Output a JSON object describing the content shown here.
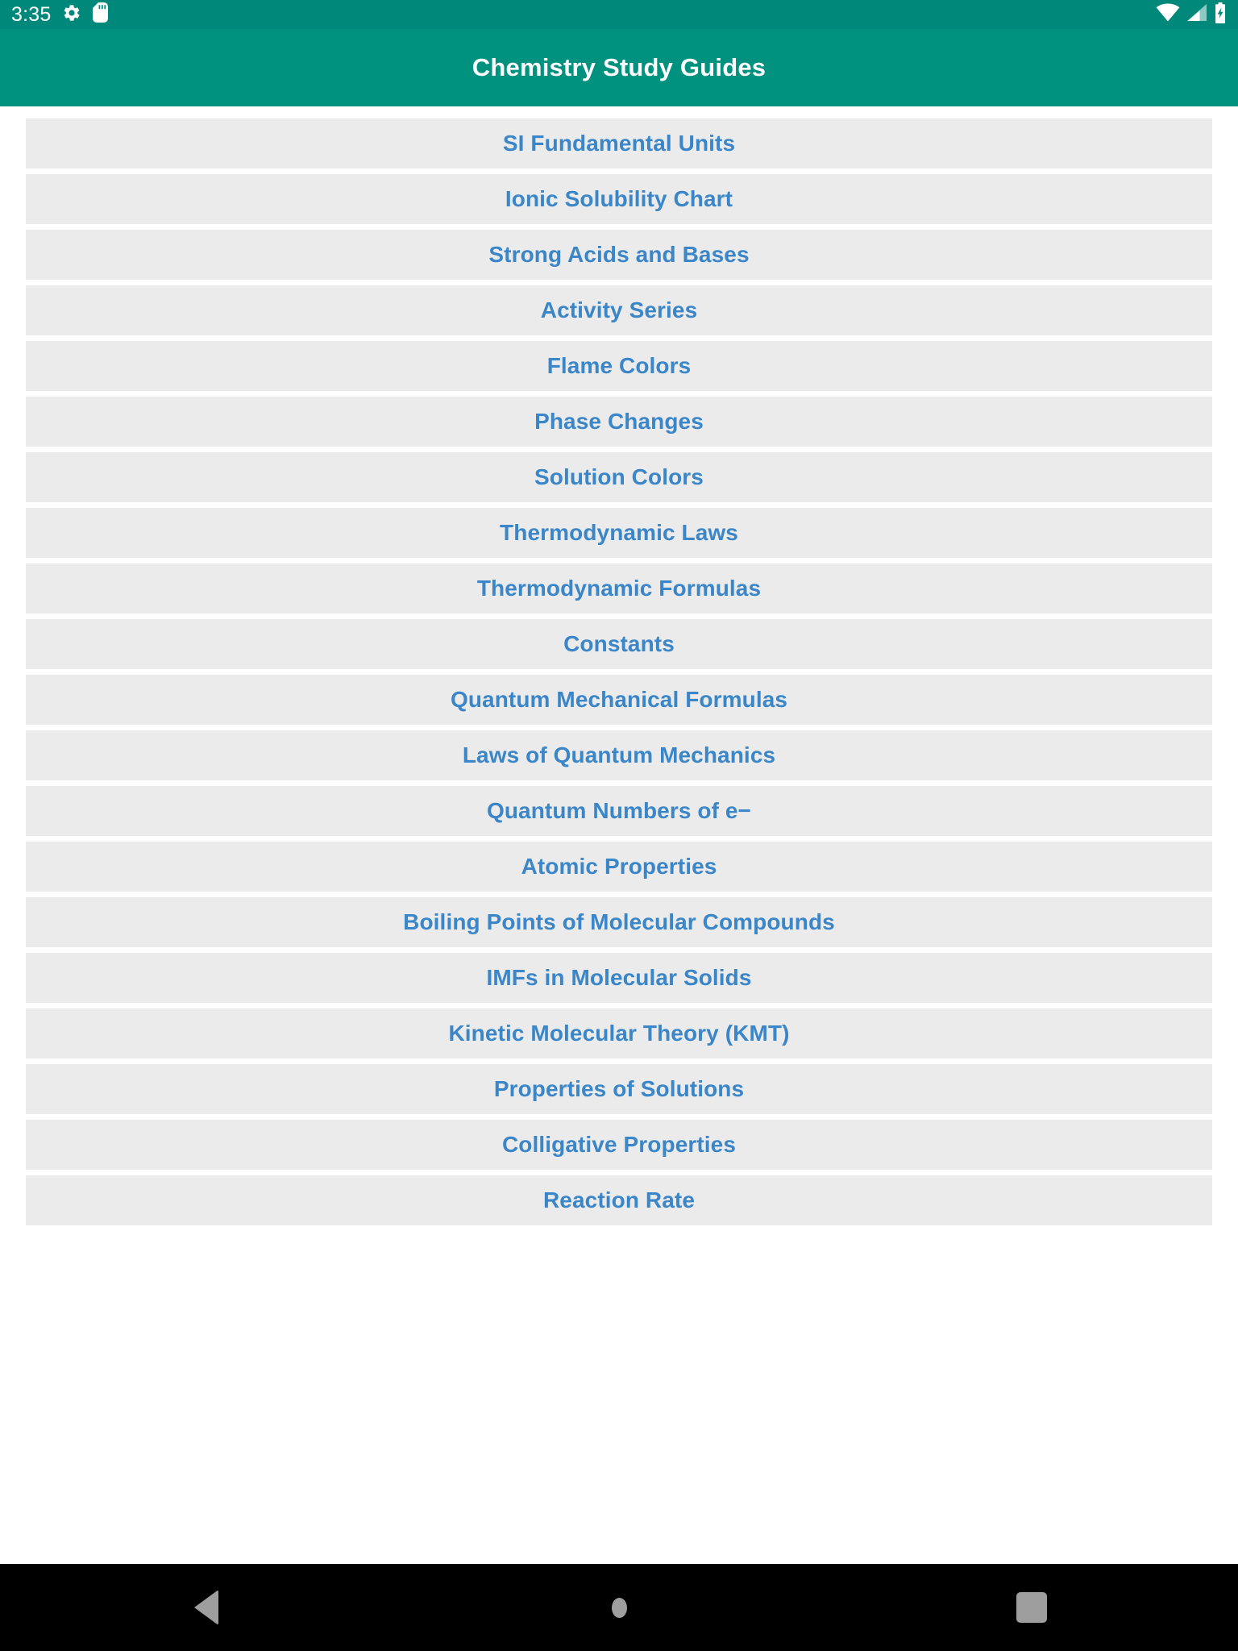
{
  "status_bar": {
    "clock": "3:35",
    "left_icons": [
      {
        "name": "settings-gear-icon",
        "glyph": "gear"
      },
      {
        "name": "sd-card-icon",
        "glyph": "sd-card"
      }
    ],
    "right_icons": [
      {
        "name": "wifi-icon",
        "glyph": "wifi"
      },
      {
        "name": "cellular-signal-icon",
        "glyph": "signal"
      },
      {
        "name": "battery-charging-icon",
        "glyph": "battery-charging"
      }
    ],
    "background_color": "#00897b",
    "foreground_color": "#ffffff"
  },
  "app_bar": {
    "title": "Chemistry Study Guides",
    "background_color": "#00917f",
    "title_color": "#ffffff"
  },
  "list": {
    "item_background_color": "#ebebeb",
    "item_text_color": "#3a86c8",
    "items": [
      {
        "label": "SI Fundamental Units"
      },
      {
        "label": "Ionic Solubility Chart"
      },
      {
        "label": "Strong Acids and Bases"
      },
      {
        "label": "Activity Series"
      },
      {
        "label": "Flame Colors"
      },
      {
        "label": "Phase Changes"
      },
      {
        "label": "Solution Colors"
      },
      {
        "label": "Thermodynamic Laws"
      },
      {
        "label": "Thermodynamic Formulas"
      },
      {
        "label": "Constants"
      },
      {
        "label": "Quantum Mechanical Formulas"
      },
      {
        "label": "Laws of Quantum Mechanics"
      },
      {
        "label": "Quantum Numbers of e−"
      },
      {
        "label": "Atomic Properties"
      },
      {
        "label": "Boiling Points of Molecular Compounds"
      },
      {
        "label": "IMFs in Molecular Solids"
      },
      {
        "label": "Kinetic Molecular Theory (KMT)"
      },
      {
        "label": "Properties of Solutions"
      },
      {
        "label": "Colligative Properties"
      },
      {
        "label": "Reaction Rate"
      }
    ]
  },
  "nav_bar": {
    "background_color": "#000000",
    "icon_color": "#9e9e9e",
    "buttons": [
      {
        "name": "back-button",
        "label": "Back"
      },
      {
        "name": "home-button",
        "label": "Home"
      },
      {
        "name": "recents-button",
        "label": "Recents"
      }
    ]
  }
}
